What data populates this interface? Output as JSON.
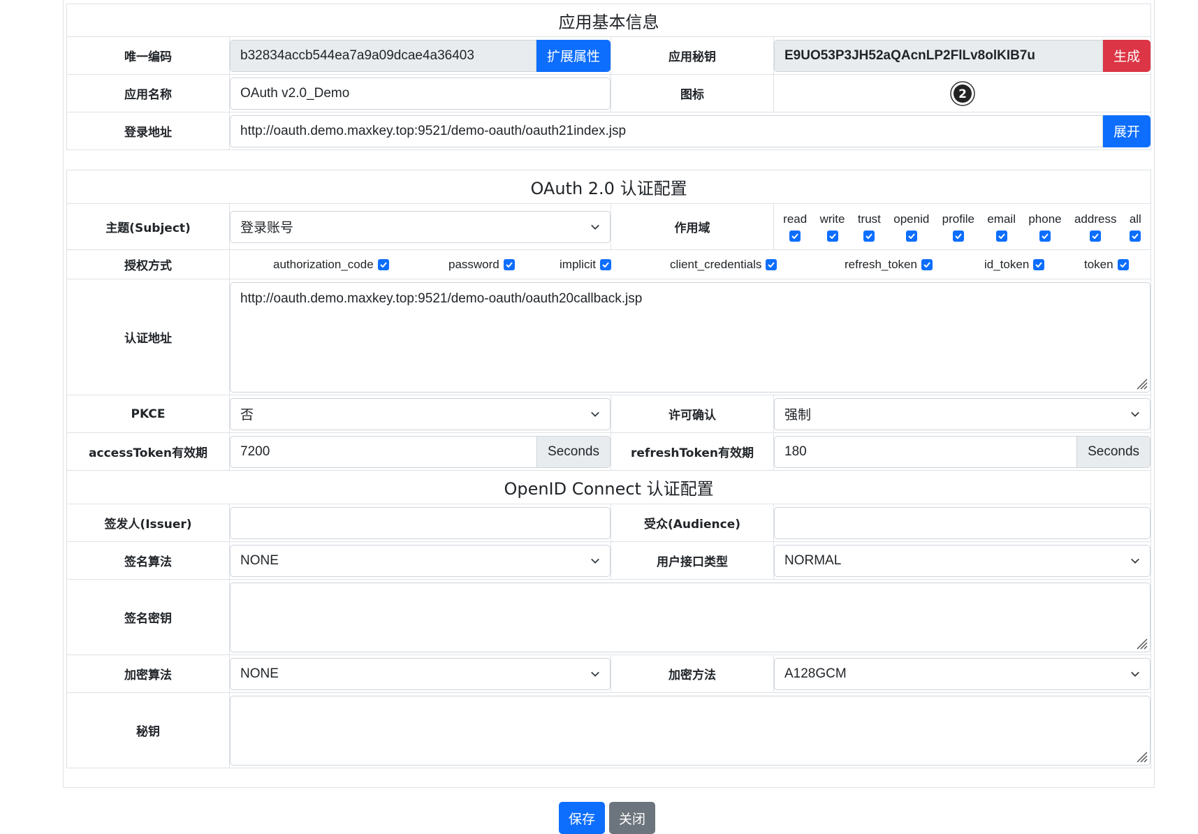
{
  "basic": {
    "section_title": "应用基本信息",
    "unique_code_label": "唯一编码",
    "unique_code_value": "b32834accb544ea7a9a09dcae4a36403",
    "extend_button": "扩展属性",
    "secret_label": "应用秘钥",
    "secret_value": "E9UO53P3JH52aQAcnLP2FlLv8olKIB7u",
    "generate_button": "生成",
    "app_name_label": "应用名称",
    "app_name_value": "OAuth v2.0_Demo",
    "icon_label": "图标",
    "icon_name": "oauth2-logo-icon",
    "login_url_label": "登录地址",
    "login_url_value": "http://oauth.demo.maxkey.top:9521/demo-oauth/oauth21index.jsp",
    "expand_button": "展开"
  },
  "oauth": {
    "section_title": "OAuth 2.0 认证配置",
    "subject_label": "主题(Subject)",
    "subject_value": "登录账号",
    "scope_label": "作用域",
    "scopes": [
      "read",
      "write",
      "trust",
      "openid",
      "profile",
      "email",
      "phone",
      "address",
      "all"
    ],
    "grant_label": "授权方式",
    "grants": [
      "authorization_code",
      "password",
      "implicit",
      "client_credentials",
      "refresh_token",
      "id_token",
      "token"
    ],
    "redirect_label": "认证地址",
    "redirect_value": "http://oauth.demo.maxkey.top:9521/demo-oauth/oauth20callback.jsp",
    "pkce_label": "PKCE",
    "pkce_value": "否",
    "approval_label": "许可确认",
    "approval_value": "强制",
    "access_token_label": "accessToken有效期",
    "access_token_value": "7200",
    "access_token_unit": "Seconds",
    "refresh_token_label": "refreshToken有效期",
    "refresh_token_value": "180",
    "refresh_token_unit": "Seconds"
  },
  "oidc": {
    "section_title": "OpenID Connect 认证配置",
    "issuer_label": "签发人(Issuer)",
    "issuer_value": "",
    "audience_label": "受众(Audience)",
    "audience_value": "",
    "sign_alg_label": "签名算法",
    "sign_alg_value": "NONE",
    "userinfo_type_label": "用户接口类型",
    "userinfo_type_value": "NORMAL",
    "sign_key_label": "签名密钥",
    "sign_key_value": "",
    "enc_alg_label": "加密算法",
    "enc_alg_value": "NONE",
    "enc_method_label": "加密方法",
    "enc_method_value": "A128GCM",
    "secret_key_label": "秘钥",
    "secret_key_value": ""
  },
  "footer": {
    "save_button": "保存",
    "close_button": "关闭"
  },
  "colors": {
    "primary": "#0d6efd",
    "danger": "#dc3545",
    "secondary": "#6c757d"
  }
}
